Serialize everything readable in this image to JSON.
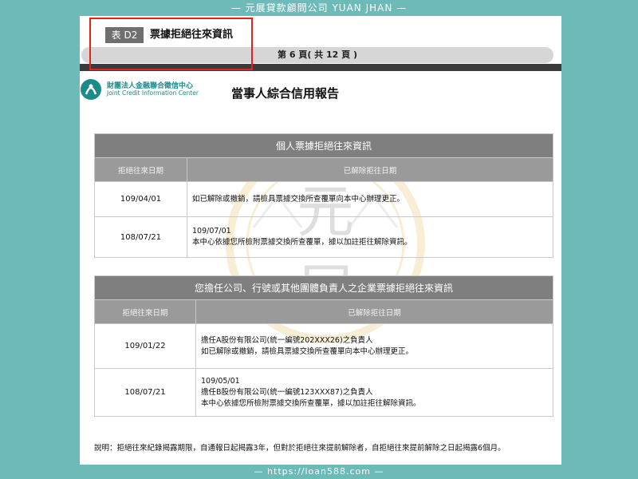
{
  "banner": {
    "top": "— 元展貸款顧問公司 YUAN JHAN —",
    "bottom": "— https://loan588.com —"
  },
  "form": {
    "tag": "表 D2",
    "title": "票據拒絕往來資訊",
    "page_indicator": "第 6 頁( 共 12 頁 )"
  },
  "logo": {
    "name_cn": "財團法人金融聯合徵信中心",
    "name_en": "Joint Credit Information Center"
  },
  "report_title": "當事人綜合信用報告",
  "watermark": {
    "text_top": "元",
    "text_bottom": "展"
  },
  "section_personal": {
    "title": "個人票據拒絕往來資訊",
    "columns": [
      "拒絕往來日期",
      "已解除拒往日期"
    ],
    "rows": [
      {
        "date": "109/04/01",
        "lines": [
          "如已解除或撤銷，請檢具票據交換所查覆單向本中心辦理更正。"
        ]
      },
      {
        "date": "108/07/21",
        "lines": [
          "109/07/01",
          "本中心依據您所檢附票據交換所查覆單，據以加註拒往解除資訊。"
        ]
      }
    ]
  },
  "section_company": {
    "title": "您擔任公司、行號或其他團體負責人之企業票據拒絕往來資訊",
    "columns": [
      "拒絕往來日期",
      "已解除拒往日期"
    ],
    "rows": [
      {
        "date": "109/01/22",
        "lines": [
          "擔任A股份有限公司(統一編號202XXX26)之負責人",
          "如已解除或撤銷，請檢具票據交換所查覆單向本中心辦理更正。"
        ]
      },
      {
        "date": "108/07/21",
        "lines": [
          "109/05/01",
          "擔任B股份有限公司(統一編號123XXX87)之負責人",
          "本中心依據您所檢附票據交換所查覆單，據以加註拒往解除資訊。"
        ]
      }
    ]
  },
  "note": "說明：拒絕往來紀錄揭露期限，自通報日起揭露3年，但對於拒絕往來提前解除者，自拒絕往來提前解除之日起揭露6個月。",
  "colors": {
    "background": "#6dbbb9",
    "header_gray": "#7f7f7f",
    "highlight_red": "#e0231b",
    "logo_teal": "#1d8a8a"
  }
}
